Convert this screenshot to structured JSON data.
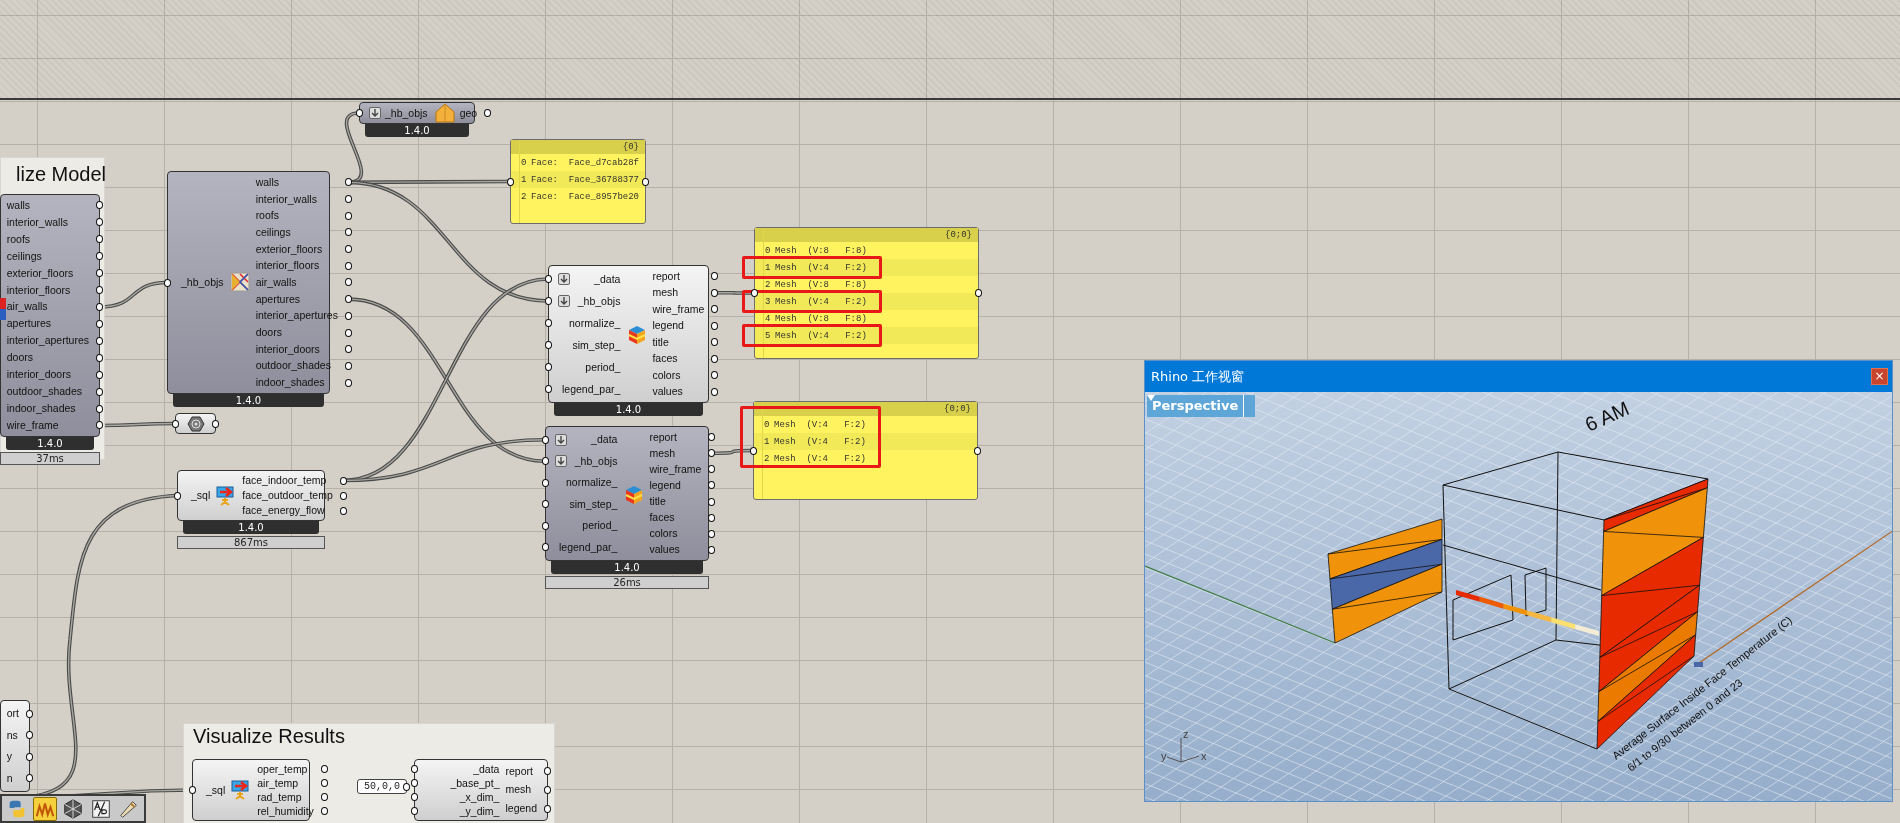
{
  "groups": [
    {
      "title": "lize Model"
    },
    {
      "title": "Visualize Results"
    }
  ],
  "components": [
    {
      "preview": false,
      "outputs": [
        "walls",
        "interior_walls",
        "roofs",
        "ceilings",
        "exterior_floors",
        "interior_floors",
        "air_walls",
        "apertures",
        "interior_apertures",
        "doors",
        "interior_doors",
        "outdoor_shades",
        "indoor_shades",
        "wire_frame"
      ],
      "version": "1.4.0",
      "timing": "37ms"
    },
    {
      "preview": false,
      "inputs": [
        {
          "name": "_hb_objs",
          "flatten": false
        }
      ],
      "outputs": [
        "walls",
        "interior_walls",
        "roofs",
        "ceilings",
        "exterior_floors",
        "interior_floors",
        "air_walls",
        "apertures",
        "interior_apertures",
        "doors",
        "interior_doors",
        "outdoor_shades",
        "indoor_shades"
      ],
      "version": "1.4.0"
    },
    {
      "preview": false,
      "inputs": [
        {
          "name": "_hb_objs",
          "flatten": true
        }
      ],
      "outputs": [
        "geo"
      ],
      "version": "1.4.0"
    },
    {
      "preview": true,
      "inputs": [
        {
          "name": "_data",
          "flatten": true
        },
        {
          "name": "_hb_objs",
          "flatten": true
        },
        {
          "name": "normalize_",
          "flatten": false
        },
        {
          "name": "sim_step_",
          "flatten": false
        },
        {
          "name": "period_",
          "flatten": false
        },
        {
          "name": "legend_par_",
          "flatten": false
        }
      ],
      "outputs": [
        "report",
        "mesh",
        "wire_frame",
        "legend",
        "title",
        "faces",
        "colors",
        "values"
      ],
      "version": "1.4.0"
    },
    {
      "preview": true,
      "inputs": [
        {
          "name": "_sql",
          "flatten": false
        }
      ],
      "outputs": [
        "face_indoor_temp",
        "face_outdoor_temp",
        "face_energy_flow"
      ],
      "version": "1.4.0",
      "timing": "867ms"
    },
    {
      "preview": false,
      "inputs": [
        {
          "name": "_data",
          "flatten": true
        },
        {
          "name": "_hb_objs",
          "flatten": true
        },
        {
          "name": "normalize_",
          "flatten": false
        },
        {
          "name": "sim_step_",
          "flatten": false
        },
        {
          "name": "period_",
          "flatten": false
        },
        {
          "name": "legend_par_",
          "flatten": false
        }
      ],
      "outputs": [
        "report",
        "mesh",
        "wire_frame",
        "legend",
        "title",
        "faces",
        "colors",
        "values"
      ],
      "version": "1.4.0",
      "timing": "26ms"
    },
    {
      "preview": true,
      "outputs": [
        "ort",
        "ns",
        "y",
        "n"
      ]
    },
    {
      "preview": true,
      "inputs": [
        {
          "name": "_sql",
          "flatten": false
        }
      ],
      "outputs": [
        "oper_temp",
        "air_temp",
        "rad_temp",
        "rel_humidity"
      ]
    },
    {
      "preview": true,
      "inputs": [
        {
          "name": "_data",
          "flatten": false
        },
        {
          "name": "_base_pt_",
          "flatten": false
        },
        {
          "name": "_x_dim_",
          "flatten": false
        },
        {
          "name": "_y_dim_",
          "flatten": false
        }
      ],
      "outputs": [
        "report",
        "mesh",
        "legend"
      ]
    }
  ],
  "panels": [
    {
      "header": "{0}",
      "highlighted": false,
      "rows": [
        {
          "index": "0",
          "text": "Face:  Face_d7cab28f",
          "highlighted": false
        },
        {
          "index": "1",
          "text": "Face:  Face_36788377",
          "highlighted": false
        },
        {
          "index": "2",
          "text": "Face:  Face_8957be20",
          "highlighted": false
        }
      ]
    },
    {
      "header": "{0;0}",
      "highlighted": false,
      "rows": [
        {
          "index": "0",
          "text": "Mesh  (V:8   F:8)",
          "highlighted": false
        },
        {
          "index": "1",
          "text": "Mesh  (V:4   F:2)",
          "highlighted": true
        },
        {
          "index": "2",
          "text": "Mesh  (V:8   F:8)",
          "highlighted": false
        },
        {
          "index": "3",
          "text": "Mesh  (V:4   F:2)",
          "highlighted": true
        },
        {
          "index": "4",
          "text": "Mesh  (V:8   F:8)",
          "highlighted": false
        },
        {
          "index": "5",
          "text": "Mesh  (V:4   F:2)",
          "highlighted": true
        }
      ]
    },
    {
      "header": "{0;0}",
      "highlighted": true,
      "rows": [
        {
          "index": "0",
          "text": "Mesh  (V:4   F:2)",
          "highlighted": false
        },
        {
          "index": "1",
          "text": "Mesh  (V:4   F:2)",
          "highlighted": false
        },
        {
          "index": "2",
          "text": "Mesh  (V:4   F:2)",
          "highlighted": false
        }
      ]
    }
  ],
  "number_input": {
    "value": "50,0,0"
  },
  "toolbar": [
    {
      "selected": false
    },
    {
      "selected": true
    },
    {
      "selected": false
    },
    {
      "selected": false
    },
    {
      "selected": false
    }
  ],
  "viewport": {
    "title": "Rhino 工作视窗",
    "close": "×",
    "view_label": "Perspective",
    "scene_labels": [
      "6 AM",
      "Average Surface Inside Face Temperature (C)",
      "6/1 to 9/30 between 0 and 23"
    ],
    "axis_labels": [
      "z",
      "y",
      "x"
    ]
  }
}
